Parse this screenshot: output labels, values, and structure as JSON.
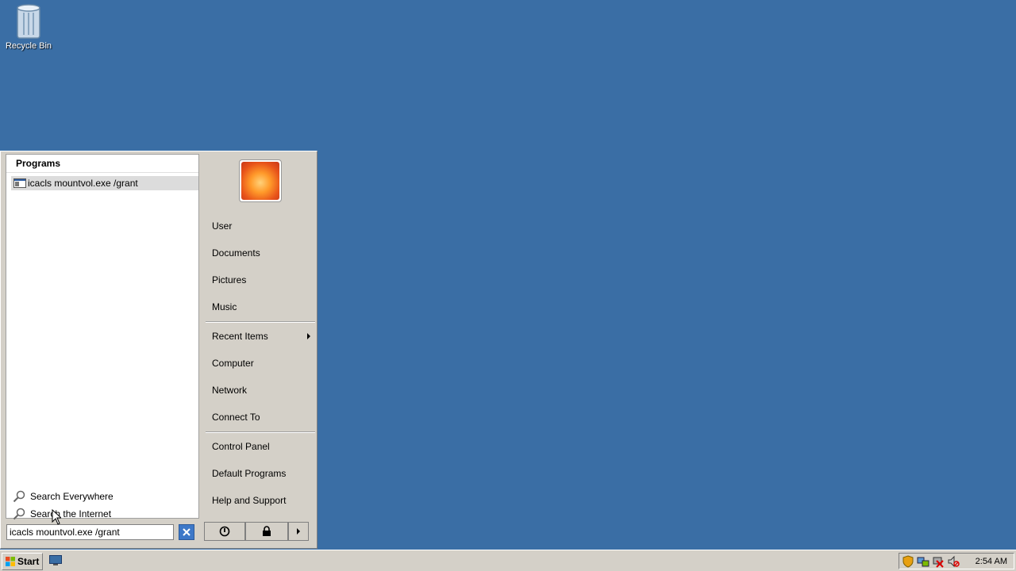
{
  "desktop": {
    "recycle_bin_label": "Recycle Bin"
  },
  "start_menu": {
    "programs_header": "Programs",
    "result_item_label": "icacls mountvol.exe /grant",
    "search_everywhere_label": "Search Everywhere",
    "search_internet_label": "Search the Internet",
    "search_value": "icacls mountvol.exe /grant",
    "right_items": {
      "user": "User",
      "documents": "Documents",
      "pictures": "Pictures",
      "music": "Music",
      "recent_items": "Recent Items",
      "computer": "Computer",
      "network": "Network",
      "connect_to": "Connect To",
      "control_panel": "Control Panel",
      "default_programs": "Default Programs",
      "help_support": "Help and Support"
    }
  },
  "taskbar": {
    "start_label": "Start",
    "clock": "2:54 AM"
  },
  "colors": {
    "desktop": "#3a6ea5",
    "menu_face": "#d4d0c8",
    "highlight": "#dcdcdc"
  },
  "icons": [
    "recycle-bin-icon",
    "program-icon",
    "search-icon",
    "clear-search-icon",
    "power-icon",
    "lock-icon",
    "arrow-right-icon",
    "windows-logo-icon",
    "show-desktop-icon",
    "shield-icon",
    "network-icon",
    "disconnected-icon",
    "volume-muted-icon"
  ]
}
